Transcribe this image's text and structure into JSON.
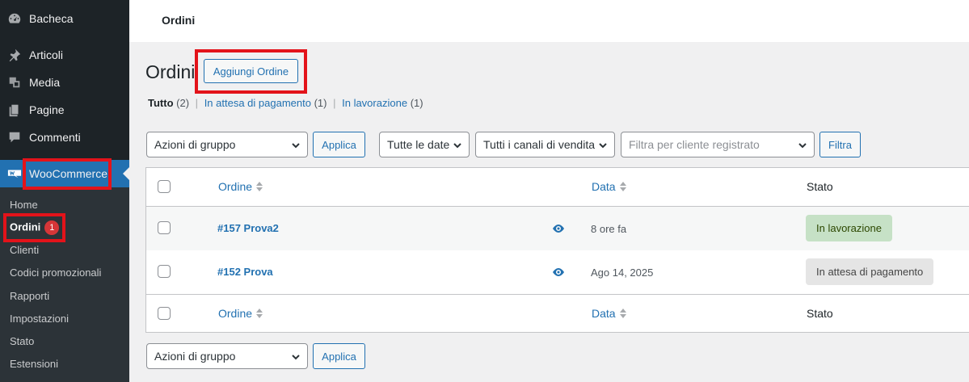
{
  "sidebar": {
    "items": [
      {
        "label": "Bacheca",
        "icon": "dashboard-icon"
      },
      {
        "label": "Articoli",
        "icon": "pin-icon"
      },
      {
        "label": "Media",
        "icon": "media-icon"
      },
      {
        "label": "Pagine",
        "icon": "pages-icon"
      },
      {
        "label": "Commenti",
        "icon": "comments-icon"
      },
      {
        "label": "WooCommerce",
        "icon": "woocommerce-icon"
      }
    ],
    "submenu": [
      {
        "label": "Home"
      },
      {
        "label": "Ordini",
        "badge": "1"
      },
      {
        "label": "Clienti"
      },
      {
        "label": "Codici promozionali"
      },
      {
        "label": "Rapporti"
      },
      {
        "label": "Impostazioni"
      },
      {
        "label": "Stato"
      },
      {
        "label": "Estensioni"
      }
    ]
  },
  "header": {
    "title": "Ordini"
  },
  "main": {
    "page_title": "Ordini",
    "add_order_label": "Aggiungi Ordine",
    "views": {
      "all_label": "Tutto",
      "all_count": "(2)",
      "pending_label": "In attesa di pagamento",
      "pending_count": "(1)",
      "processing_label": "In lavorazione",
      "processing_count": "(1)"
    },
    "bulk_actions": "Azioni di gruppo",
    "apply_label": "Applica",
    "date_filter": "Tutte le date",
    "channel_filter": "Tutti i canali di vendita",
    "customer_filter_placeholder": "Filtra per cliente registrato",
    "filter_label": "Filtra"
  },
  "table": {
    "columns": {
      "order": "Ordine",
      "date": "Data",
      "status": "Stato"
    },
    "rows": [
      {
        "order": "#157 Prova2",
        "date": "8 ore fa",
        "status": "In lavorazione"
      },
      {
        "order": "#152 Prova",
        "date": "Ago 14, 2025",
        "status": "In attesa di pagamento"
      }
    ]
  },
  "colors": {
    "accent": "#2271b1",
    "sidebar_bg": "#1d2327",
    "highlight_box": "#e3131a",
    "badge": "#d63638"
  }
}
